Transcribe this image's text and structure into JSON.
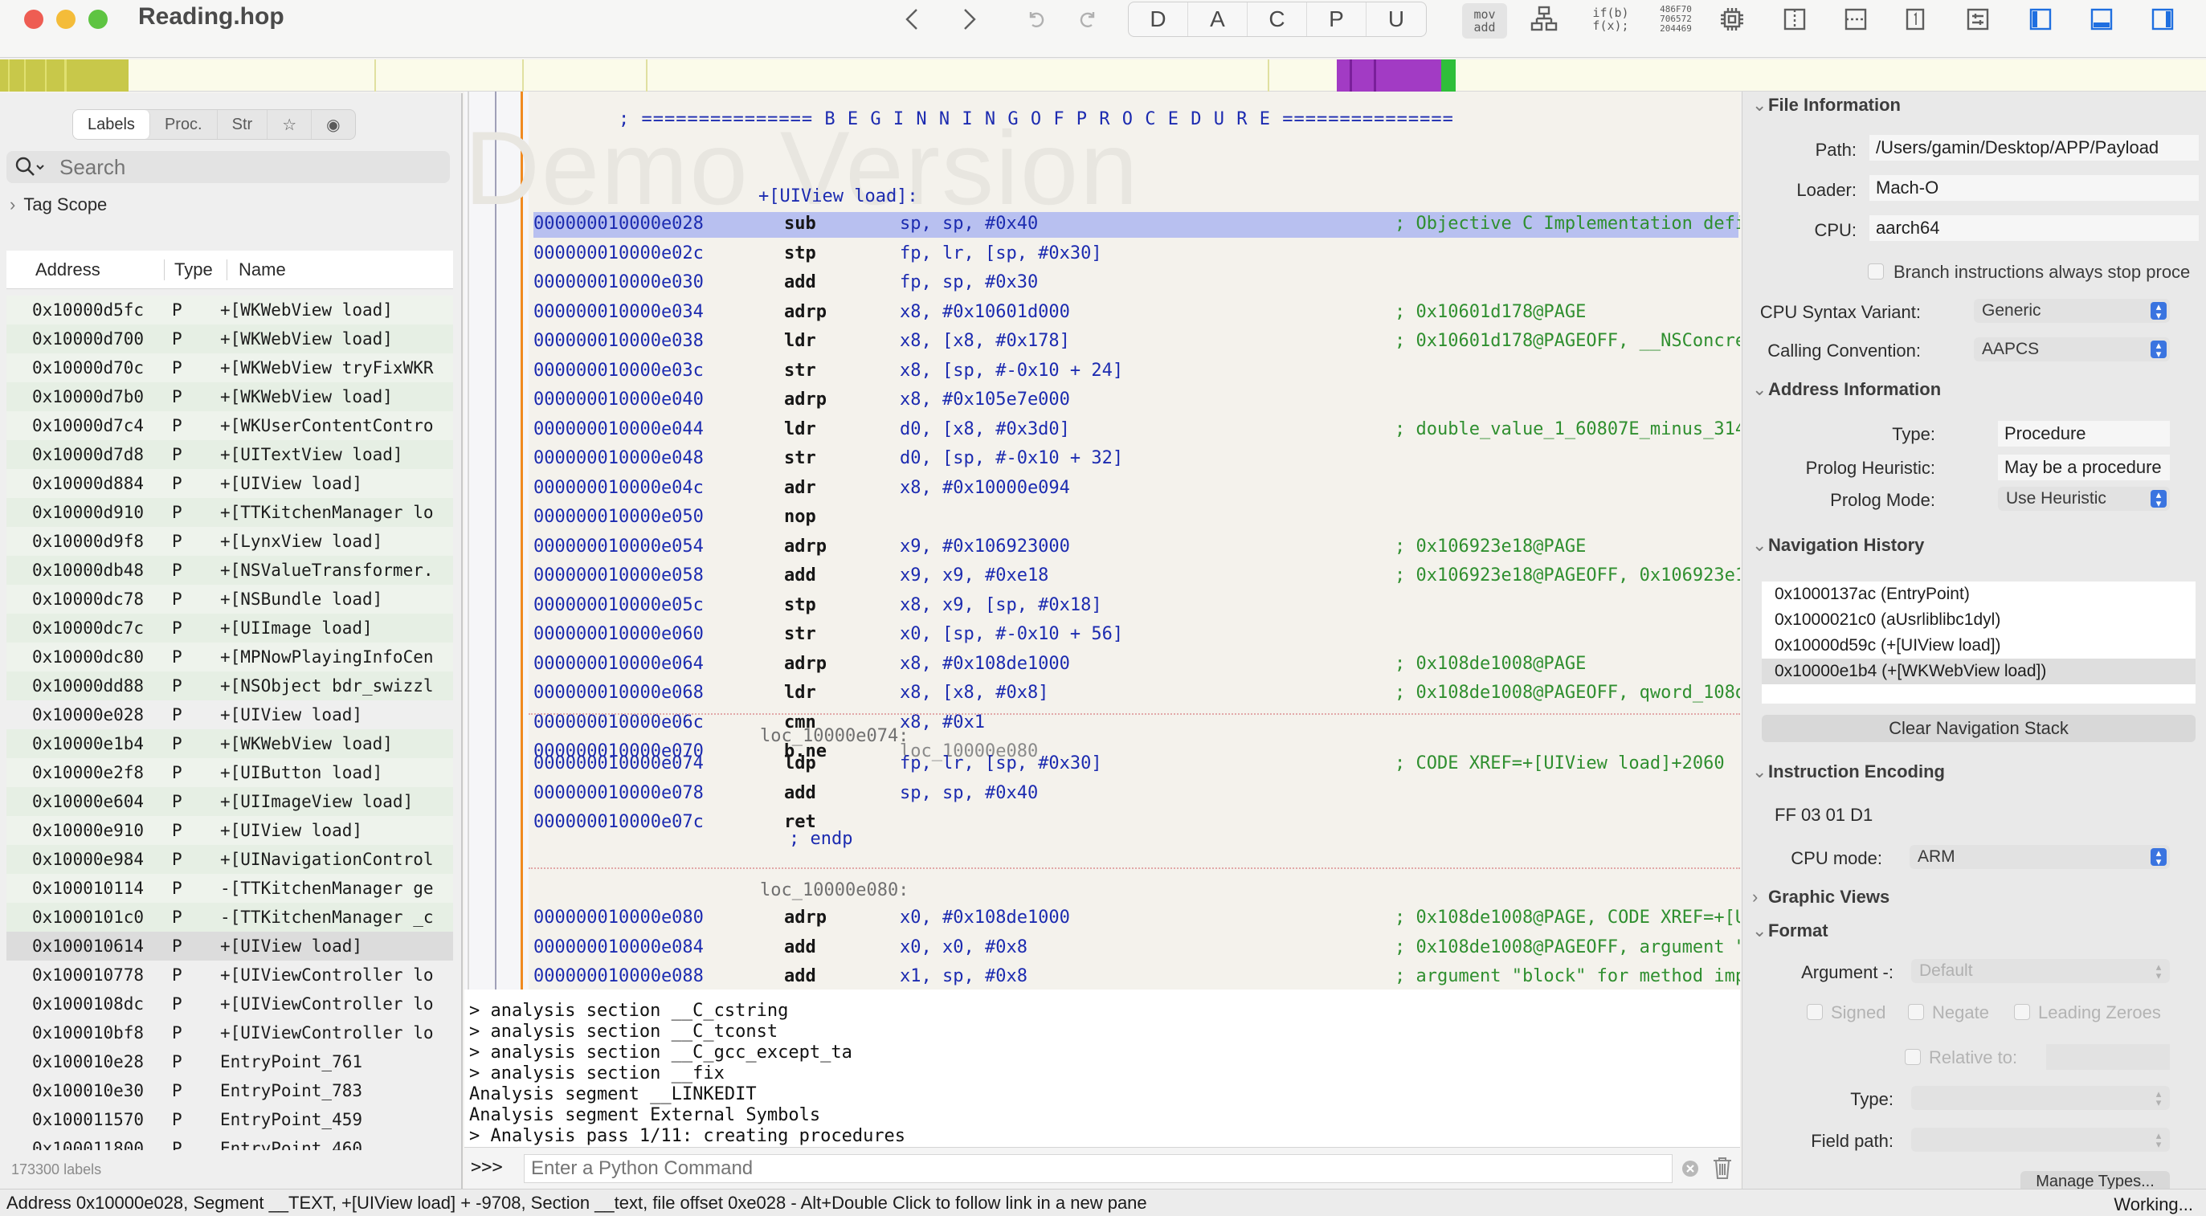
{
  "window": {
    "title": "Reading.hop"
  },
  "toolbar": {
    "mode_buttons": [
      "D",
      "A",
      "C",
      "P",
      "U"
    ],
    "mov_add": "mov\nadd",
    "ifb": "if(b)\nf(x);",
    "hex": "486F70\n706572\n204469"
  },
  "sidebar": {
    "tabs": [
      "Labels",
      "Proc.",
      "Str",
      "☆",
      "◉"
    ],
    "search_placeholder": "Search",
    "tag_scope": "Tag Scope",
    "columns": [
      "Address",
      "Type",
      "Name"
    ],
    "rows": [
      {
        "addr": "0x10000d5fc",
        "type": "P",
        "name": "+[WKWebView load]"
      },
      {
        "addr": "0x10000d700",
        "type": "P",
        "name": "+[WKWebView load]"
      },
      {
        "addr": "0x10000d70c",
        "type": "P",
        "name": "+[WKWebView tryFixWKR"
      },
      {
        "addr": "0x10000d7b0",
        "type": "P",
        "name": "+[WKWebView load]"
      },
      {
        "addr": "0x10000d7c4",
        "type": "P",
        "name": "+[WKUserContentContro"
      },
      {
        "addr": "0x10000d7d8",
        "type": "P",
        "name": "+[UITextView load]"
      },
      {
        "addr": "0x10000d884",
        "type": "P",
        "name": "+[UIView load]"
      },
      {
        "addr": "0x10000d910",
        "type": "P",
        "name": "+[TTKitchenManager lo"
      },
      {
        "addr": "0x10000d9f8",
        "type": "P",
        "name": "+[LynxView load]"
      },
      {
        "addr": "0x10000db48",
        "type": "P",
        "name": "+[NSValueTransformer."
      },
      {
        "addr": "0x10000dc78",
        "type": "P",
        "name": "+[NSBundle load]"
      },
      {
        "addr": "0x10000dc7c",
        "type": "P",
        "name": "+[UIImage load]"
      },
      {
        "addr": "0x10000dc80",
        "type": "P",
        "name": "+[MPNowPlayingInfoCen"
      },
      {
        "addr": "0x10000dd88",
        "type": "P",
        "name": "+[NSObject bdr_swizzl"
      },
      {
        "addr": "0x10000e028",
        "type": "P",
        "name": "+[UIView load]"
      },
      {
        "addr": "0x10000e1b4",
        "type": "P",
        "name": "+[WKWebView load]"
      },
      {
        "addr": "0x10000e2f8",
        "type": "P",
        "name": "+[UIButton load]"
      },
      {
        "addr": "0x10000e604",
        "type": "P",
        "name": "+[UIImageView load]"
      },
      {
        "addr": "0x10000e910",
        "type": "P",
        "name": "+[UIView load]"
      },
      {
        "addr": "0x10000e984",
        "type": "P",
        "name": "+[UINavigationControl"
      },
      {
        "addr": "0x100010114",
        "type": "P",
        "name": "-[TTKitchenManager ge"
      },
      {
        "addr": "0x1000101c0",
        "type": "P",
        "name": "-[TTKitchenManager _c"
      },
      {
        "addr": "0x100010614",
        "type": "P",
        "name": "+[UIView load]"
      },
      {
        "addr": "0x100010778",
        "type": "P",
        "name": "+[UIViewController lo"
      },
      {
        "addr": "0x1000108dc",
        "type": "P",
        "name": "+[UIViewController lo"
      },
      {
        "addr": "0x100010bf8",
        "type": "P",
        "name": "+[UIViewController lo"
      },
      {
        "addr": "0x100010e28",
        "type": "P",
        "name": "EntryPoint_761"
      },
      {
        "addr": "0x100010e30",
        "type": "P",
        "name": "EntryPoint_783"
      },
      {
        "addr": "0x100011570",
        "type": "P",
        "name": "EntryPoint_459"
      },
      {
        "addr": "0x100011800",
        "type": "P",
        "name": "EntryPoint_460"
      }
    ],
    "label_count": "173300 labels"
  },
  "disasm": {
    "watermark": "Demo Version",
    "banner": "; =============== B E G I N N I N G   O F   P R O C E D U R E ===============",
    "proc_label": "+[UIView load]:",
    "lines1": [
      {
        "addr": "000000010000e028",
        "mn": "sub",
        "op": "sp, sp, #0x40",
        "cm": "; Objective C Implementation defi"
      },
      {
        "addr": "000000010000e02c",
        "mn": "stp",
        "op": "fp, lr, [sp, #0x30]",
        "cm": ""
      },
      {
        "addr": "000000010000e030",
        "mn": "add",
        "op": "fp, sp, #0x30",
        "cm": ""
      },
      {
        "addr": "000000010000e034",
        "mn": "adrp",
        "op": "x8, #0x10601d000",
        "cm": "; 0x10601d178@PAGE"
      },
      {
        "addr": "000000010000e038",
        "mn": "ldr",
        "op": "x8, [x8, #0x178]",
        "cm": "; 0x10601d178@PAGEOFF, __NSConcre"
      },
      {
        "addr": "000000010000e03c",
        "mn": "str",
        "op": "x8, [sp, #-0x10 + 24]",
        "cm": ""
      },
      {
        "addr": "000000010000e040",
        "mn": "adrp",
        "op": "x8, #0x105e7e000",
        "cm": ""
      },
      {
        "addr": "000000010000e044",
        "mn": "ldr",
        "op": "d0, [x8, #0x3d0]",
        "cm": "; double_value_1_60807E_minus_314"
      },
      {
        "addr": "000000010000e048",
        "mn": "str",
        "op": "d0, [sp, #-0x10 + 32]",
        "cm": ""
      },
      {
        "addr": "000000010000e04c",
        "mn": "adr",
        "op": "x8, #0x10000e094",
        "cm": ""
      },
      {
        "addr": "000000010000e050",
        "mn": "nop",
        "op": "",
        "cm": ""
      },
      {
        "addr": "000000010000e054",
        "mn": "adrp",
        "op": "x9, #0x106923000",
        "cm": "; 0x106923e18@PAGE"
      },
      {
        "addr": "000000010000e058",
        "mn": "add",
        "op": "x9, x9, #0xe18",
        "cm": "; 0x106923e18@PAGEOFF, 0x106923e1"
      },
      {
        "addr": "000000010000e05c",
        "mn": "stp",
        "op": "x8, x9, [sp, #0x18]",
        "cm": ""
      },
      {
        "addr": "000000010000e060",
        "mn": "str",
        "op": "x0, [sp, #-0x10 + 56]",
        "cm": ""
      },
      {
        "addr": "000000010000e064",
        "mn": "adrp",
        "op": "x8, #0x108de1000",
        "cm": "; 0x108de1008@PAGE"
      },
      {
        "addr": "000000010000e068",
        "mn": "ldr",
        "op": "x8, [x8, #0x8]",
        "cm": "; 0x108de1008@PAGEOFF, qword_108d"
      },
      {
        "addr": "000000010000e06c",
        "mn": "cmn",
        "op": "x8, #0x1",
        "cm": ""
      },
      {
        "addr": "000000010000e070",
        "mn": "b.ne",
        "op": "loc_10000e080",
        "cm": ""
      }
    ],
    "loc1": "loc_10000e074:",
    "lines2": [
      {
        "addr": "000000010000e074",
        "mn": "ldp",
        "op": "fp, lr, [sp, #0x30]",
        "cm": "; CODE XREF=+[UIView load]+2060"
      },
      {
        "addr": "000000010000e078",
        "mn": "add",
        "op": "sp, sp, #0x40",
        "cm": ""
      },
      {
        "addr": "000000010000e07c",
        "mn": "ret",
        "op": "",
        "cm": ""
      }
    ],
    "endp": "; endp",
    "loc2": "loc_10000e080:",
    "lines3": [
      {
        "addr": "000000010000e080",
        "mn": "adrp",
        "op": "x0, #0x108de1000",
        "cm": "; 0x108de1008@PAGE, CODE XREF=+[U"
      },
      {
        "addr": "000000010000e084",
        "mn": "add",
        "op": "x0, x0, #0x8",
        "cm": "; 0x108de1008@PAGEOFF, argument \""
      },
      {
        "addr": "000000010000e088",
        "mn": "add",
        "op": "x1, sp, #0x8",
        "cm": "; argument \"block\" for method imp"
      }
    ]
  },
  "console": {
    "lines": [
      "> analysis section __C_cstring",
      "> analysis section __C_tconst",
      "> analysis section __C_gcc_except_ta",
      "> analysis section __fix",
      "Analysis segment __LINKEDIT",
      "Analysis segment External Symbols",
      "> Analysis pass 1/11: creating procedures"
    ],
    "prompt": ">>>",
    "placeholder": "Enter a Python Command"
  },
  "inspector": {
    "file_info": {
      "title": "File Information",
      "path_label": "Path:",
      "path": "/Users/gamin/Desktop/APP/Payload",
      "loader_label": "Loader:",
      "loader": "Mach-O",
      "cpu_label": "CPU:",
      "cpu": "aarch64",
      "branch_check": "Branch instructions always stop proce",
      "syntax_label": "CPU Syntax Variant:",
      "syntax": "Generic",
      "calling_label": "Calling Convention:",
      "calling": "AAPCS"
    },
    "addr_info": {
      "title": "Address Information",
      "type_label": "Type:",
      "type": "Procedure",
      "prolog_heur_label": "Prolog Heuristic:",
      "prolog_heur": "May be a procedure",
      "prolog_mode_label": "Prolog Mode:",
      "prolog_mode": "Use Heuristic"
    },
    "nav_history": {
      "title": "Navigation History",
      "items": [
        "0x1000137ac (EntryPoint)",
        "0x1000021c0 (aUsrliblibc1dyl)",
        "0x10000d59c (+[UIView load])",
        "0x10000e1b4 (+[WKWebView load])"
      ],
      "clear": "Clear Navigation Stack"
    },
    "encoding": {
      "title": "Instruction Encoding",
      "bytes": "FF 03 01 D1",
      "mode_label": "CPU mode:",
      "mode": "ARM"
    },
    "graphic_views": "Graphic Views",
    "format": {
      "title": "Format",
      "argument_label": "Argument -:",
      "argument": "Default",
      "signed": "Signed",
      "negate": "Negate",
      "leading": "Leading Zeroes",
      "relative": "Relative to:",
      "type_label": "Type:",
      "field_label": "Field path:",
      "manage": "Manage Types..."
    }
  },
  "status": {
    "text": "Address 0x10000e028, Segment __TEXT, +[UIView load] + -9708, Section __text, file offset 0xe028 - Alt+Double Click to follow link in a new pane",
    "right": "Working..."
  },
  "colors": {
    "accent": "#3a74e0",
    "highlight": "#b8c0f0",
    "address": "#1c2bb0",
    "comment": "#2f8f2f"
  }
}
